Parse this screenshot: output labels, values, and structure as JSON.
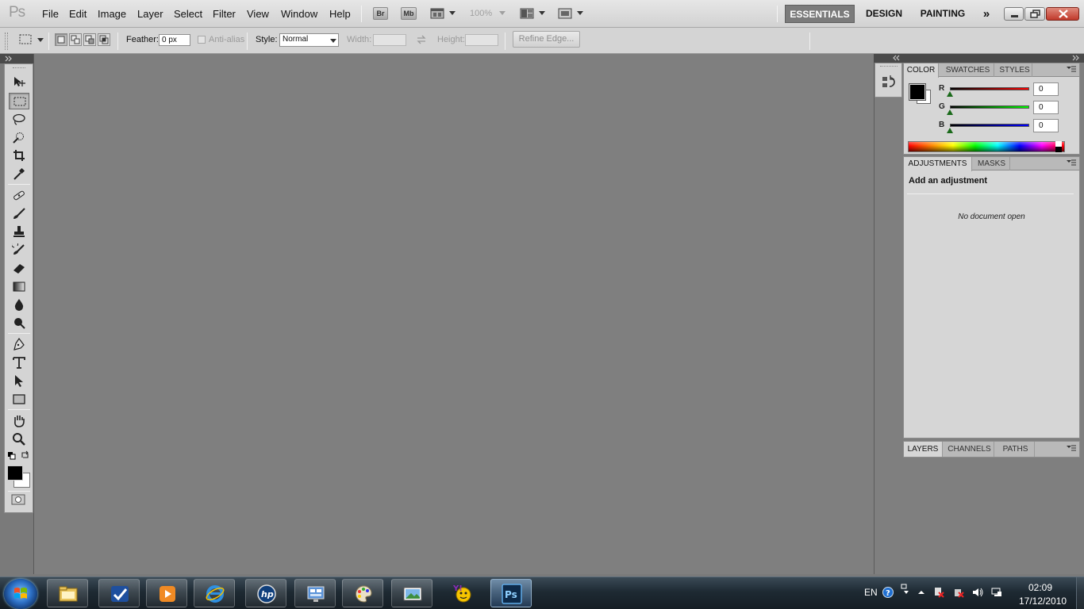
{
  "app": {
    "logo": "Ps"
  },
  "menu": {
    "items": [
      "File",
      "Edit",
      "Image",
      "Layer",
      "Select",
      "Filter",
      "View",
      "Window",
      "Help"
    ]
  },
  "appbar": {
    "bridge": "Br",
    "minibridge": "Mb",
    "zoom": "100%"
  },
  "workspaces": {
    "items": [
      "ESSENTIALS",
      "DESIGN",
      "PAINTING"
    ],
    "active": "ESSENTIALS",
    "more": "»"
  },
  "options": {
    "feather_label": "Feather:",
    "feather_value": "0 px",
    "antialias_label": "Anti-alias",
    "style_label": "Style:",
    "style_value": "Normal",
    "width_label": "Width:",
    "height_label": "Height:",
    "refine_edge": "Refine Edge..."
  },
  "color_panel": {
    "tabs": [
      "COLOR",
      "SWATCHES",
      "STYLES"
    ],
    "channels": [
      {
        "label": "R",
        "value": "0",
        "color": "#e00000"
      },
      {
        "label": "G",
        "value": "0",
        "color": "#00c000"
      },
      {
        "label": "B",
        "value": "0",
        "color": "#0000e0"
      }
    ],
    "foreground": "#000000",
    "background": "#ffffff"
  },
  "adjustments_panel": {
    "tabs": [
      "ADJUSTMENTS",
      "MASKS"
    ],
    "heading": "Add an adjustment",
    "empty_message": "No document open"
  },
  "layers_panel": {
    "tabs": [
      "LAYERS",
      "CHANNELS",
      "PATHS"
    ]
  },
  "tools": [
    "move-tool",
    "rectangular-marquee-tool",
    "lasso-tool",
    "quick-selection-tool",
    "crop-tool",
    "eyedropper-tool",
    "spot-healing-tool",
    "brush-tool",
    "clone-stamp-tool",
    "history-brush-tool",
    "eraser-tool",
    "gradient-tool",
    "blur-tool",
    "dodge-tool",
    "pen-tool",
    "type-tool",
    "path-selection-tool",
    "rectangle-tool",
    "hand-tool",
    "zoom-tool"
  ],
  "taskbar": {
    "apps": [
      "windows-explorer",
      "check-app",
      "media-player",
      "internet-explorer",
      "hp-app",
      "control-app",
      "paint-app",
      "photo-app",
      "yahoo-messenger",
      "photoshop"
    ],
    "language": "EN",
    "time": "02:09",
    "date": "17/12/2010"
  }
}
